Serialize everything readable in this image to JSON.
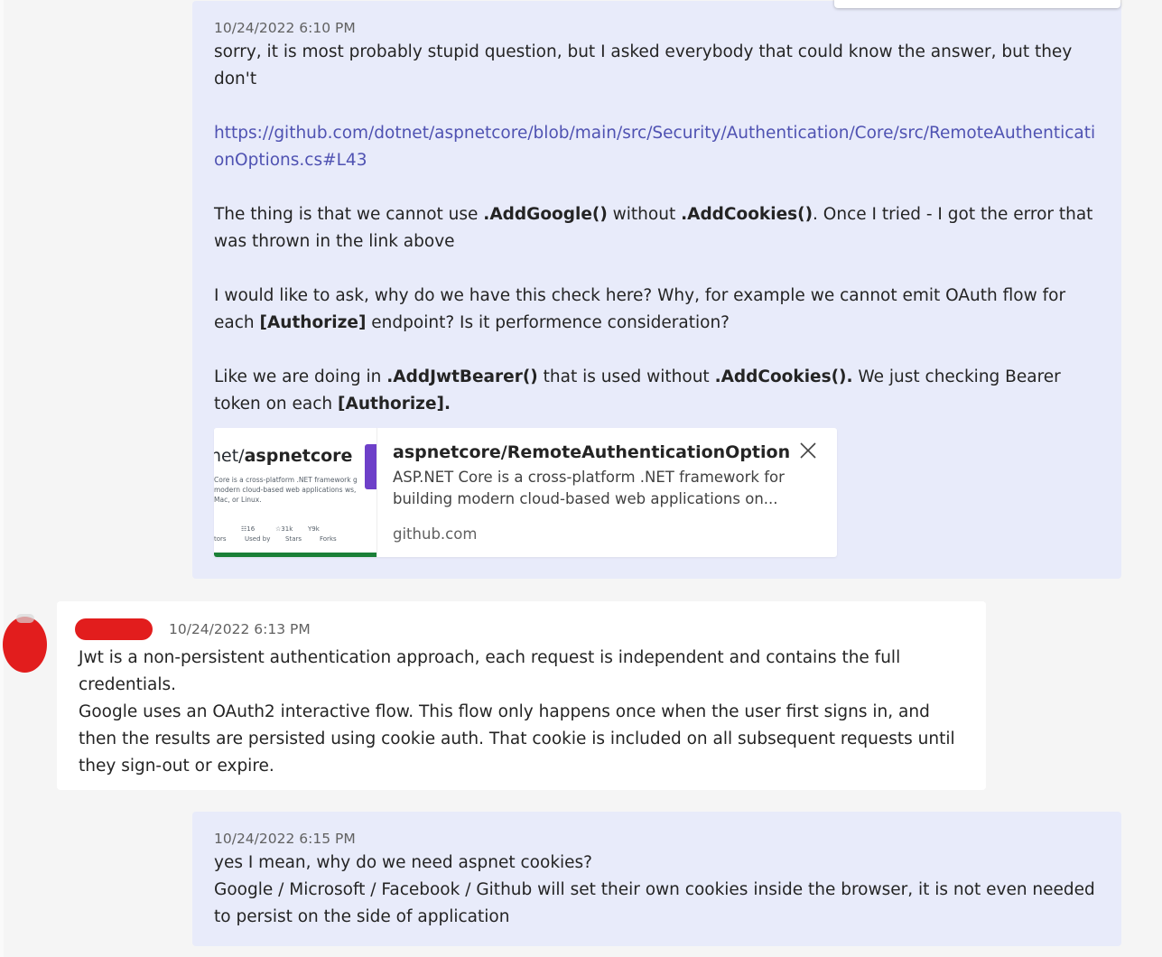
{
  "messages": {
    "m1": {
      "timestamp": "10/24/2022 6:10 PM",
      "p1": "sorry, it is most probably stupid question, but I asked everybody that could know the answer, but they don't",
      "link": "https://github.com/dotnet/aspnetcore/blob/main/src/Security/Authentication/Core/src/RemoteAuthenticationOptions.cs#L43",
      "p3": {
        "t1": "The thing is that we cannot use ",
        "b1": ".AddGoogle()",
        "t2": " without ",
        "b2": ".AddCookies()",
        "t3": ". Once I tried - I got the error that was thrown in the link above"
      },
      "p4": {
        "t1": "I would like to ask, why do we have this check here? Why, for example we cannot emit OAuth flow for each ",
        "b1": "[Authorize]",
        "t2": " endpoint? Is it performence consideration?"
      },
      "p5": {
        "t1": "Like we are doing in ",
        "b1": ".AddJwtBearer()",
        "t2": " that is used without ",
        "b2": ".AddCookies().",
        "t3": " We just checking Bearer token on each ",
        "b3": "[Authorize]."
      },
      "preview": {
        "thumb_title_prefix": "net/",
        "thumb_title_bold": "aspnetcore",
        "thumb_desc": "Core is a cross-platform .NET framework g modern cloud-based web applications ws, Mac, or Linux.",
        "thumb_stats": [
          "tors",
          "16",
          "Used by",
          "31k",
          "Stars",
          "9k",
          "Forks"
        ],
        "title": "aspnetcore/RemoteAuthenticationOptions.c...",
        "description": "ASP.NET Core is a cross-platform .NET framework for building modern cloud-based web applications on...",
        "domain": "github.com",
        "close_icon": "close-icon"
      }
    },
    "m2": {
      "timestamp": "10/24/2022 6:13 PM",
      "p1": "Jwt is a non-persistent authentication approach, each request is independent and contains the full credentials.",
      "p2": "Google uses an OAuth2 interactive flow. This flow only happens once when the user first signs in, and then the results are persisted using cookie auth. That cookie is included on all subsequent requests until they sign-out or expire."
    },
    "m3": {
      "timestamp": "10/24/2022 6:15 PM",
      "p1": "yes I mean, why do we need aspnet cookies?",
      "p2": "Google / Microsoft / Facebook / Github will set their own cookies inside the browser, it is not even needed to persist on the side of application"
    }
  },
  "colors": {
    "own_bubble": "#e8ebfa",
    "other_bubble": "#ffffff",
    "link": "#4f52b2",
    "redaction": "#e21d1d"
  }
}
